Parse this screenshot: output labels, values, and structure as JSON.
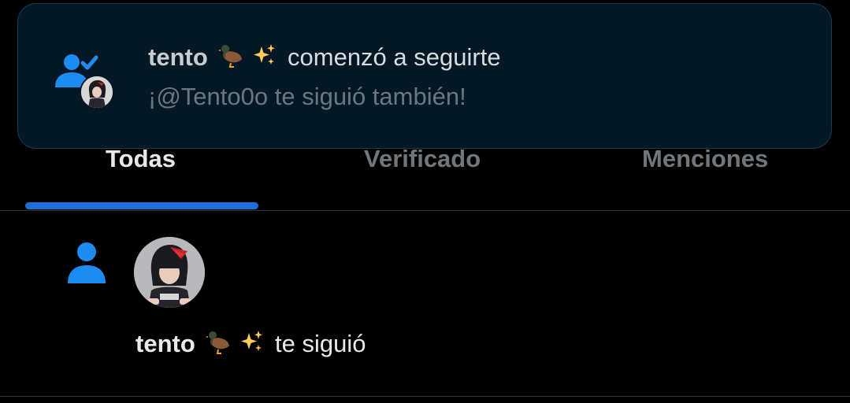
{
  "tabs": [
    {
      "label": "Todas",
      "active": true
    },
    {
      "label": "Verificado",
      "active": false
    },
    {
      "label": "Menciones",
      "active": false
    }
  ],
  "toast": {
    "name": "tento",
    "emoji": [
      "duck",
      "sparkles"
    ],
    "action": "comenzó a seguirte",
    "subtitle": "¡@Tento0o te siguió también!",
    "icon": "person-check-icon"
  },
  "notification": {
    "icon": "person-icon",
    "name": "tento",
    "emoji": [
      "duck",
      "sparkles"
    ],
    "action": "te siguió"
  },
  "colors": {
    "accent": "#1d70d8",
    "background": "#000000",
    "toast_background": "#041725",
    "muted_text": "#71767b"
  }
}
